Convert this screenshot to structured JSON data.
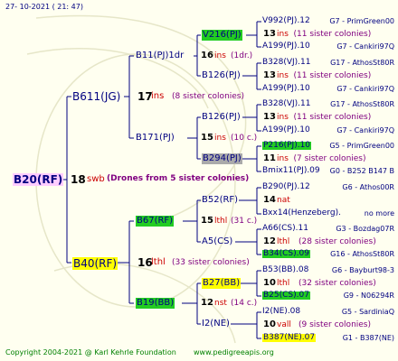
{
  "header": {
    "timestamp": "27- 10-2021 ( 21: 47)"
  },
  "footer": {
    "copyright": "Copyright 2004-2021 @ Karl Kehrle Foundation",
    "website": "www.pedigreeapis.org"
  },
  "root": {
    "name": "B20(RF)",
    "gen": "18",
    "ins": "swb",
    "note": "(Drones from 5 sister colonies)"
  },
  "lvl1": [
    {
      "name": "B611(JG)",
      "gen": "17",
      "ins": "ins",
      "note": "(8 sister colonies)"
    },
    {
      "name": "B40(RF)",
      "gen": "16",
      "ins": "lthl",
      "note": "(33 sister colonies)"
    }
  ],
  "lvl2": [
    {
      "name": "B11(PJ)1dr",
      "gen": "16",
      "ins": "ins",
      "note": "(1dr.)"
    },
    {
      "name": "B171(PJ)",
      "gen": "15",
      "ins": "ins",
      "note": "(10 c.)"
    },
    {
      "name": "B67(RF)",
      "gen": "15",
      "ins": "lthl",
      "note": "(31 c.)"
    },
    {
      "name": "B19(BB)",
      "gen": "12",
      "ins": "nst",
      "note": "(14 c.)"
    }
  ],
  "lvl3": [
    {
      "name": "V216(PJ)"
    },
    {
      "name": "B126(PJ)"
    },
    {
      "name": "B126(PJ)"
    },
    {
      "name": "B294(PJ)"
    },
    {
      "name": "B52(RF)"
    },
    {
      "name": "A5(CS)"
    },
    {
      "name": "B27(BB)"
    },
    {
      "name": "I2(NE)"
    }
  ],
  "right": [
    {
      "name": "V992(PJ).12",
      "code": "G7 - PrimGreen00"
    },
    {
      "gen": "13",
      "ins": "ins",
      "note": "(11 sister colonies)"
    },
    {
      "name": "A199(PJ).10",
      "code": "G7 - Cankiri97Q"
    },
    {
      "name": "B328(VJ).11",
      "code": "G17 - AthosSt80R"
    },
    {
      "gen": "13",
      "ins": "ins",
      "note": "(11 sister colonies)"
    },
    {
      "name": "A199(PJ).10",
      "code": "G7 - Cankiri97Q"
    },
    {
      "name": "B328(VJ).11",
      "code": "G17 - AthosSt80R"
    },
    {
      "gen": "13",
      "ins": "ins",
      "note": "(11 sister colonies)"
    },
    {
      "name": "A199(PJ).10",
      "code": "G7 - Cankiri97Q"
    },
    {
      "name": "P216(PJ).10",
      "code": "G5 - PrimGreen00"
    },
    {
      "gen": "11",
      "ins": "ins",
      "note": "(7 sister colonies)"
    },
    {
      "name": "Bmix11(PJ).09",
      "code": "G0 - B252 B147 B"
    },
    {
      "name": "B290(PJ).12",
      "code": "G6 - Athos00R"
    },
    {
      "gen": "14",
      "ins": "nat",
      "note": ""
    },
    {
      "name": "Bxx14(Henzeberg).",
      "code": "no more"
    },
    {
      "name": "A66(CS).11",
      "code": "G3 - Bozdag07R"
    },
    {
      "gen": "12",
      "ins": "lthl",
      "note": "(28 sister colonies)"
    },
    {
      "name": "B34(CS).09",
      "code": "G16 - AthosSt80R"
    },
    {
      "name": "B53(BB).08",
      "code": "G6 - Bayburt98-3"
    },
    {
      "gen": "10",
      "ins": "lthl",
      "note": "(32 sister colonies)"
    },
    {
      "name": "B25(CS).07",
      "code": "G9 - N06294R"
    },
    {
      "name": "I2(NE).08",
      "code": "G5 - SardiniaQ"
    },
    {
      "gen": "10",
      "ins": "vall",
      "note": "(9 sister colonies)"
    },
    {
      "name": "B387(NE).07",
      "code": "G1 - B387(NE)"
    }
  ]
}
